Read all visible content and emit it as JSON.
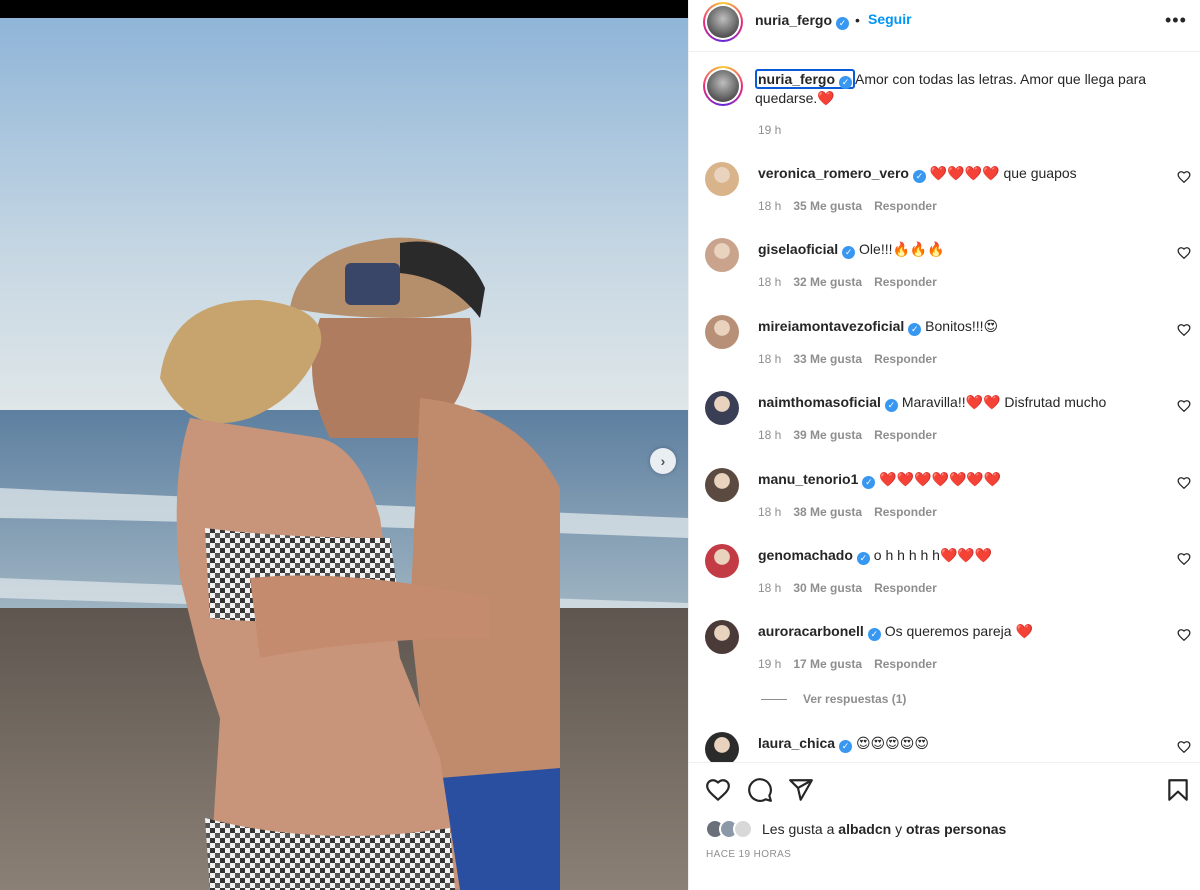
{
  "header": {
    "username": "nuria_fergo",
    "follow_label": "Seguir",
    "more_label": "•••"
  },
  "caption": {
    "username": "nuria_fergo",
    "text": "Amor con todas las letras. Amor que llega para quedarse.",
    "emoji": "❤️",
    "time": "19 h"
  },
  "comments": [
    {
      "user": "veronica_romero_vero",
      "text": "❤️❤️❤️❤️ que guapos",
      "time": "18 h",
      "likes": "35 Me gusta",
      "reply": "Responder",
      "avatar_color": "#d9b48a"
    },
    {
      "user": "giselaoficial",
      "text": "Ole!!!🔥🔥🔥",
      "time": "18 h",
      "likes": "32 Me gusta",
      "reply": "Responder",
      "avatar_color": "#c9a38c"
    },
    {
      "user": "mireiamontavezoficial",
      "text": "Bonitos!!!😍",
      "time": "18 h",
      "likes": "33 Me gusta",
      "reply": "Responder",
      "avatar_color": "#b89078"
    },
    {
      "user": "naimthomasoficial",
      "text": "Maravilla!!❤️❤️ Disfrutad mucho",
      "time": "18 h",
      "likes": "39 Me gusta",
      "reply": "Responder",
      "avatar_color": "#3a3f56"
    },
    {
      "user": "manu_tenorio1",
      "text": "❤️❤️❤️❤️❤️❤️❤️",
      "time": "18 h",
      "likes": "38 Me gusta",
      "reply": "Responder",
      "avatar_color": "#5a4a40"
    },
    {
      "user": "genomachado",
      "text": "o h h h h h❤️❤️❤️",
      "time": "18 h",
      "likes": "30 Me gusta",
      "reply": "Responder",
      "avatar_color": "#c23b45"
    },
    {
      "user": "auroracarbonell",
      "text": "Os queremos pareja ❤️",
      "time": "19 h",
      "likes": "17 Me gusta",
      "reply": "Responder",
      "avatar_color": "#4a3a38"
    },
    {
      "user": "laura_chica",
      "text": "😍😍😍😍😍",
      "time": "",
      "likes": "",
      "reply": "",
      "avatar_color": "#2b2b2b"
    }
  ],
  "view_replies": "Ver respuestas (1)",
  "likes": {
    "prefix": "Les gusta a",
    "user": "albadcn",
    "joiner": "y",
    "others": "otras personas"
  },
  "post_time": "HACE 19 HORAS",
  "icons": {
    "like": "heart-icon",
    "comment": "comment-icon",
    "share": "paper-plane-icon",
    "save": "bookmark-icon",
    "next": "chevron-right-icon",
    "verified": "verified-badge-icon"
  }
}
